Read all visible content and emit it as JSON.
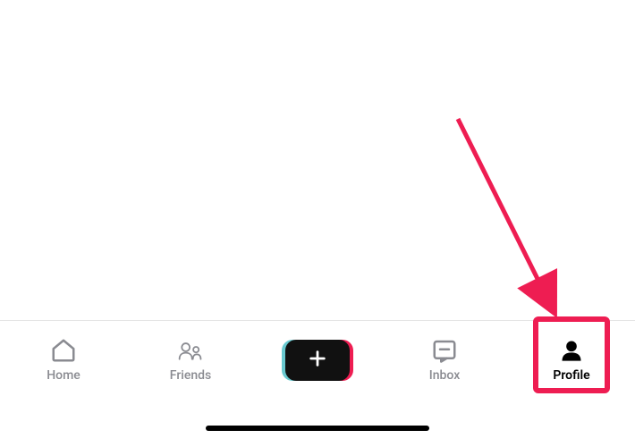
{
  "tabbar": {
    "items": [
      {
        "label": "Home",
        "icon": "home-icon",
        "active": false
      },
      {
        "label": "Friends",
        "icon": "friends-icon",
        "active": false
      },
      {
        "label": "",
        "icon": "create-icon",
        "active": false
      },
      {
        "label": "Inbox",
        "icon": "inbox-icon",
        "active": false
      },
      {
        "label": "Profile",
        "icon": "profile-icon",
        "active": true
      }
    ]
  },
  "annotation": {
    "highlight_target": "profile-tab",
    "arrow_color": "#ee1d52"
  }
}
